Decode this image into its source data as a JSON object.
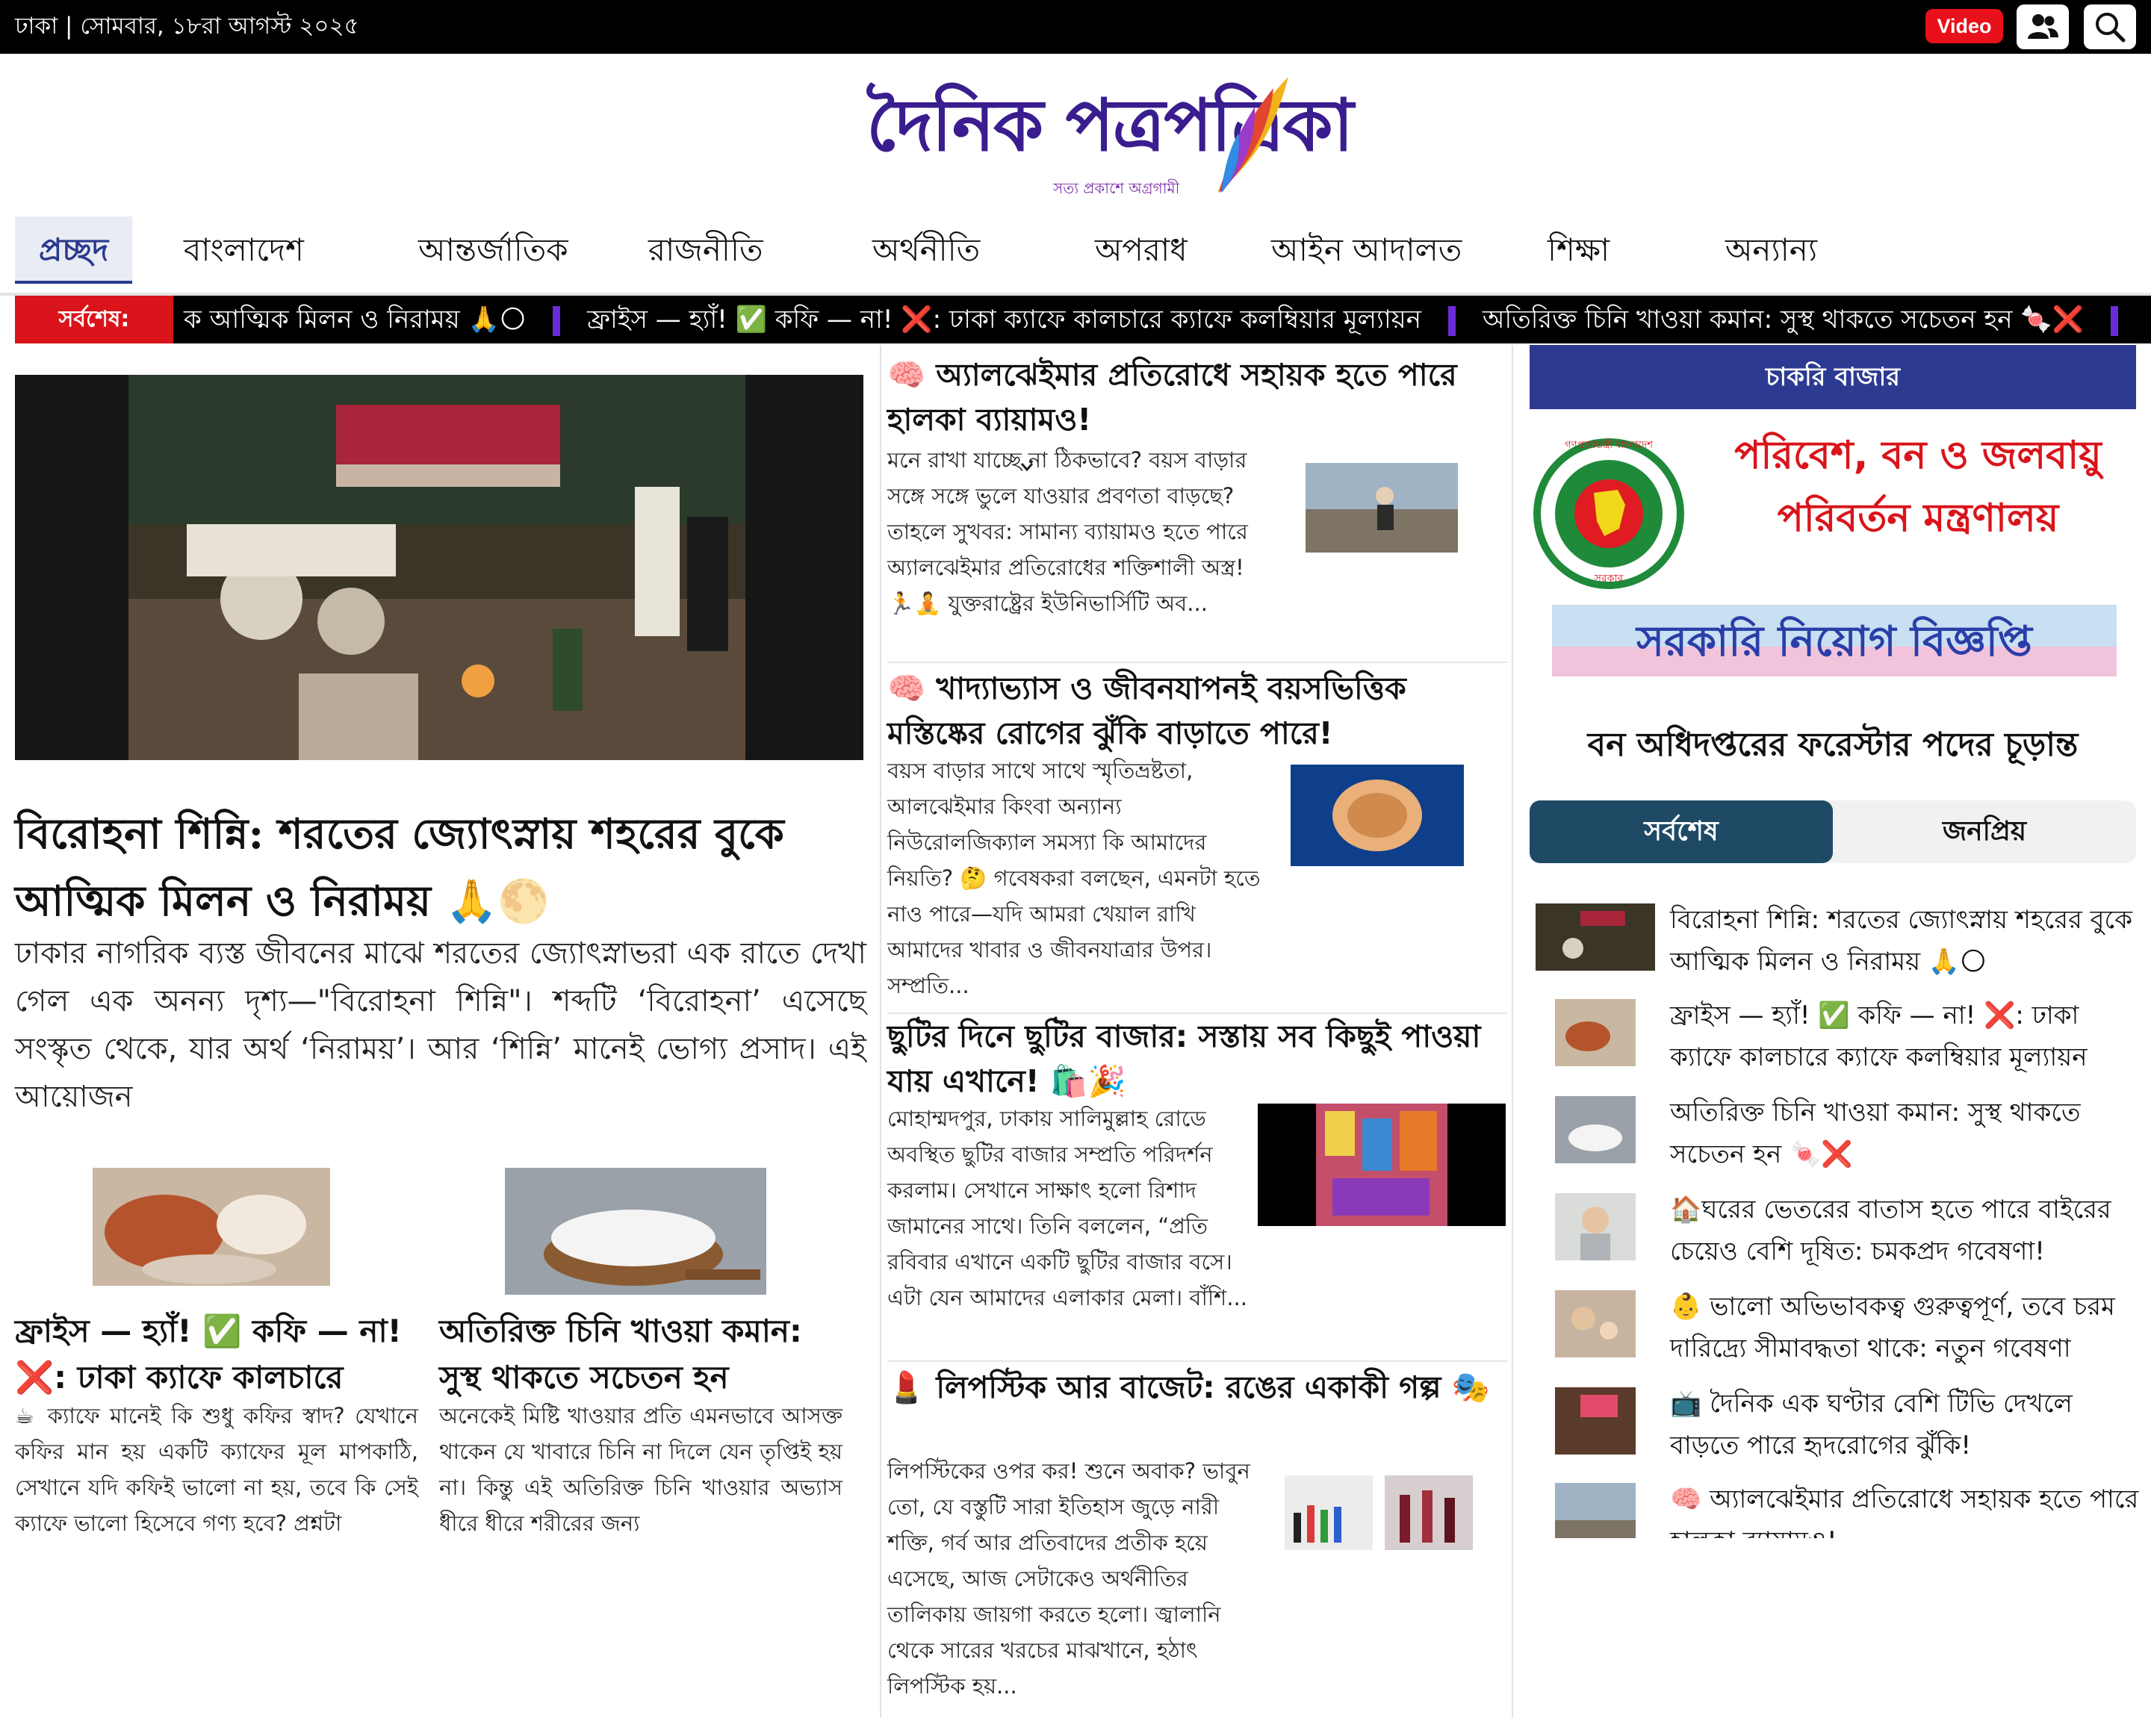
{
  "topbar": {
    "date": "ঢাকা | সোমবার, ১৮রা আগস্ট ২০২৫",
    "video_label": "Video",
    "user_icon": "users-icon",
    "search_icon": "search-icon"
  },
  "logo": {
    "wordmark": "দৈনিক পত্রপত্রিকা",
    "tagline": "সত্য প্রকাশে অগ্রগামী"
  },
  "nav": {
    "items": [
      {
        "label": "প্রচ্ছদ",
        "dropdown": false
      },
      {
        "label": "বাংলাদেশ",
        "dropdown": true
      },
      {
        "label": "আন্তর্জাতিক",
        "dropdown": false
      },
      {
        "label": "রাজনীতি",
        "dropdown": true
      },
      {
        "label": "অর্থনীতি",
        "dropdown": true
      },
      {
        "label": "অপরাধ",
        "dropdown": false
      },
      {
        "label": "আইন আদালত",
        "dropdown": false
      },
      {
        "label": "শিক্ষা",
        "dropdown": true
      },
      {
        "label": "অন্যান্য",
        "dropdown": true
      }
    ]
  },
  "ticker": {
    "label": "সর্বশেষ:",
    "items": [
      "ক আত্মিক মিলন ও নিরাময় 🙏🌕",
      "ফ্রাইস — হ্যাঁ! ✅ কফি — না! ❌: ঢাকা ক্যাফে কালচারে ক্যাফে কলম্বিয়ার মূল্যায়ন",
      "অতিরিক্ত চিনি খাওয়া কমান: সুস্থ থাকতে সচেতন হন 🍬❌"
    ]
  },
  "lead": {
    "title": "বিরোহনা শিন্নি: শরতের জ্যোৎস্নায় শহরের বুকে আত্মিক মিলন ও নিরাময় 🙏🌕",
    "body": "ঢাকার নাগরিক ব্যস্ত জীবনের মাঝে শরতের জ্যোৎস্নাভরা এক রাতে দেখা গেল এক অনন্য দৃশ্য—\"বিরোহনা শিন্নি\"। শব্দটি ‘বিরোহনা’ এসেছে সংস্কৃত থেকে, যার অর্থ ‘নিরাময়’। আর ‘শিন্নি’ মানেই ভোগ্য প্রসাদ। এই আয়োজন"
  },
  "cards": [
    {
      "title": "ফ্রাইস — হ্যাঁ! ✅ কফি — না! ❌: ঢাকা ক্যাফে কালচারে",
      "body": "☕ ক্যাফে মানেই কি শুধু কফির স্বাদ? যেখানে কফির মান হয় একটি ক্যাফের মূল মাপকাঠি, সেখানে যদি কফিই ভালো না হয়, তবে কি সেই ক্যাফে ভালো হিসেবে গণ্য হবে? প্রশ্নটা"
    },
    {
      "title": "অতিরিক্ত চিনি খাওয়া কমান: সুস্থ থাকতে সচেতন হন",
      "body": "অনেকেই মিষ্টি খাওয়ার প্রতি এমনভাবে আসক্ত থাকেন যে খাবারে চিনি না দিলে যেন তৃপ্তিই হয় না। কিন্তু এই অতিরিক্ত চিনি খাওয়ার অভ্যাস ধীরে ধীরে শরীরের জন্য"
    }
  ],
  "middle": [
    {
      "title": "🧠 অ্যালঝেইমার প্রতিরোধে সহায়ক হতে পারে হালকা ব্যায়ামও!",
      "body": "মনে রাখা যাচ্ছে না ঠিকভাবে? বয়স বাড়ার সঙ্গে সঙ্গে ভুলে যাওয়ার প্রবণতা বাড়ছে? তাহলে সুখবর: সামান্য ব্যায়ামও হতে পারে অ্যালঝেইমার প্রতিরোধের শক্তিশালী অস্ত্র! 🏃🧘 যুক্তরাষ্ট্রের ইউনিভার্সিটি অব..."
    },
    {
      "title": "🧠 খাদ্যাভ্যাস ও জীবনযাপনই বয়সভিত্তিক মস্তিষ্কের রোগের ঝুঁকি বাড়াতে পারে!",
      "body": "বয়স বাড়ার সাথে সাথে স্মৃতিভ্রষ্টতা, আলঝেইমার কিংবা অন্যান্য নিউরোলজিক্যাল সমস্যা কি আমাদের নিয়তি? 🤔 গবেষকরা বলছেন, এমনটা হতে নাও পারে—যদি আমরা খেয়াল রাখি আমাদের খাবার ও জীবনযাত্রার উপর। সম্প্রতি..."
    },
    {
      "title": "ছুটির দিনে ছুটির বাজার: সস্তায় সব কিছুই পাওয়া যায় এখানে! 🛍️🎉",
      "body": "মোহাম্মদপুর, ঢাকায় সালিমুল্লাহ রোডে অবস্থিত ছুটির বাজার সম্প্রতি পরিদর্শন করলাম। সেখানে সাক্ষাৎ হলো রিশাদ জামানের সাথে। তিনি বললেন, “প্রতি রবিবার এখানে একটি ছুটির বাজার বসে। এটা যেন আমাদের এলাকার মেলা। বাঁশি..."
    },
    {
      "title": "💄 লিপস্টিক আর বাজেট: রঙের একাকী গল্প 🎭",
      "body": "লিপস্টিকের ওপর কর! শুনে অবাক? ভাবুন তো, যে বস্তুটি সারা ইতিহাস জুড়ে নারী শক্তি, গর্ব আর প্রতিবাদের প্রতীক হয়ে এসেছে, আজ সেটাকেও অর্থনীতির তালিকায় জায়গা করতে হলো। জ্বালানি থেকে সারের খরচের মাঝখানে, হঠাৎ লিপস্টিক হয়..."
    }
  ],
  "sidebar": {
    "jobs_heading": "চাকরি বাজার",
    "banner_line1": "পরিবেশ, বন ও জলবায়ু",
    "banner_line2": "পরিবর্তন মন্ত্রণালয়",
    "banner_line3": "সরকারি নিয়োগ বিজ্ঞপ্তি",
    "seal_text_top": "গণপ্রজাতন্ত্রী বাংলাদেশ",
    "seal_text_bottom": "সরকার",
    "jobs_caption": "বন অধিদপ্তরের ফরেস্টার পদের চূড়ান্ত",
    "tabs": [
      "সর্বশেষ",
      "জনপ্রিয়"
    ],
    "latest": [
      "বিরোহনা শিন্নি: শরতের জ্যোৎস্নায় শহরের বুকে আত্মিক মিলন ও নিরাময় 🙏🌕",
      "ফ্রাইস — হ্যাঁ! ✅ কফি — না! ❌: ঢাকা ক্যাফে কালচারে ক্যাফে কলম্বিয়ার মূল্যায়ন",
      "অতিরিক্ত চিনি খাওয়া কমান: সুস্থ থাকতে সচেতন হন 🍬❌",
      "🏠ঘরের ভেতরের বাতাস হতে পারে বাইরের চেয়েও বেশি দূষিত: চমকপ্রদ গবেষণা!",
      "👶 ভালো অভিভাবকত্ব গুরুত্বপূর্ণ, তবে চরম দারিদ্র্যে সীমাবদ্ধতা থাকে: নতুন গবেষণা",
      "📺 দৈনিক এক ঘণ্টার বেশি টিভি দেখলে বাড়তে পারে হৃদরোগের ঝুঁকি!",
      "🧠 অ্যালঝেইমার প্রতিরোধে সহায়ক হতে পারে হালকা ব্যায়ামও!"
    ]
  },
  "colors": {
    "topbar": "#000000",
    "accent_red": "#d9141b",
    "nav_active": "#2a3a8f",
    "jobs_head": "#2d3a92",
    "tab_active": "#1e4a66",
    "ticker_sep": "#6c2bd9"
  }
}
